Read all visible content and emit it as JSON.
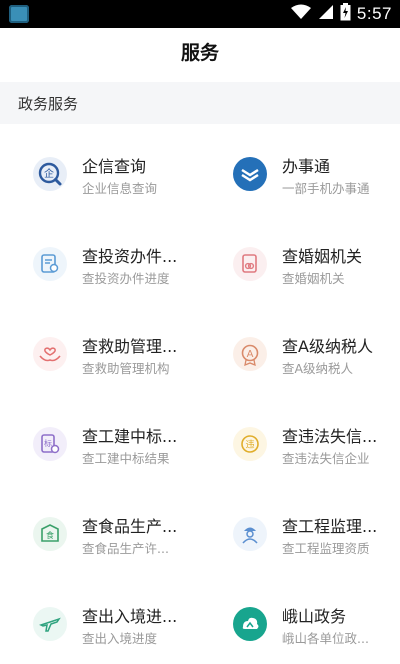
{
  "statusbar": {
    "time": "5:57"
  },
  "header": {
    "title": "服务"
  },
  "section": {
    "label": "政务服务"
  },
  "items": [
    {
      "name": "企信查询",
      "sub": "企业信息查询",
      "icon": "enterprise-query-icon"
    },
    {
      "name": "办事通",
      "sub": "一部手机办事通",
      "icon": "banshitong-icon"
    },
    {
      "name": "查投资办件...",
      "sub": "查投资办件进度",
      "icon": "investment-progress-icon"
    },
    {
      "name": "查婚姻机关",
      "sub": "查婚姻机关",
      "icon": "marriage-office-icon"
    },
    {
      "name": "查救助管理...",
      "sub": "查救助管理机构",
      "icon": "relief-management-icon"
    },
    {
      "name": "查A级纳税人",
      "sub": "查A级纳税人",
      "icon": "taxpayer-icon"
    },
    {
      "name": "查工建中标...",
      "sub": "查工建中标结果",
      "icon": "bidding-result-icon"
    },
    {
      "name": "查违法失信...",
      "sub": "查违法失信企业",
      "icon": "dishonest-enterprise-icon"
    },
    {
      "name": "查食品生产...",
      "sub": "查食品生产许...",
      "icon": "food-license-icon"
    },
    {
      "name": "查工程监理...",
      "sub": "查工程监理资质",
      "icon": "supervision-qualification-icon"
    },
    {
      "name": "查出入境进...",
      "sub": "查出入境进度",
      "icon": "entry-exit-icon"
    },
    {
      "name": "峨山政务",
      "sub": "峨山各单位政...",
      "icon": "eshan-gov-icon"
    }
  ],
  "colors": {
    "accent_blue": "#2470b8",
    "teal": "#18a58e",
    "muted": "#9a9a9a"
  }
}
